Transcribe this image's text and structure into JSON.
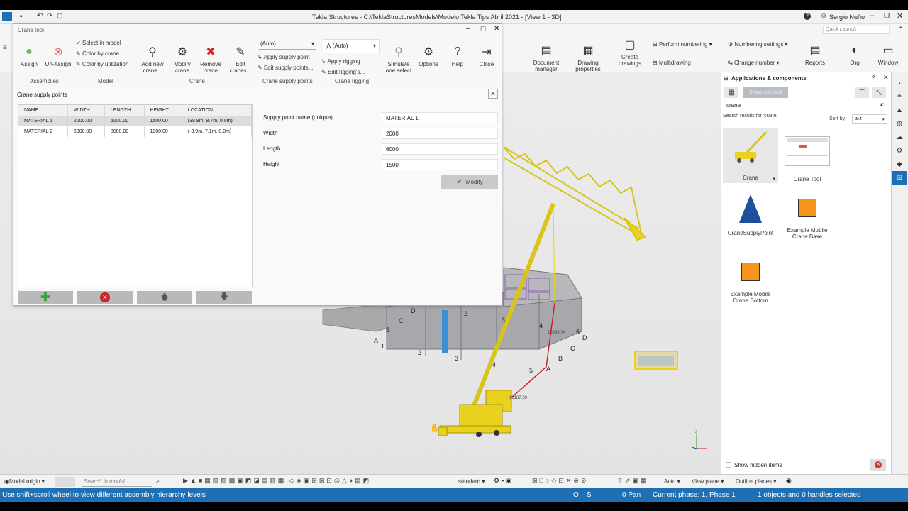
{
  "app": {
    "title": "Tekla Structures - C:\\TeklaStructuresModels\\Modelo Tekla Tips Abril 2021 - [View 1 - 3D]",
    "user": "Sergio Nuño",
    "quick_launch_placeholder": "Quick Launch"
  },
  "main_ribbon": {
    "document_manager": "Document manager",
    "drawing_properties": "Drawing properties",
    "create_drawings": "Create drawings",
    "perform_numbering": "Perform numbering",
    "multidrawing": "Multidrawing",
    "numbering_settings": "Numbering settings",
    "change_number": "Change number",
    "reports": "Reports",
    "org": "Org",
    "window": "Window"
  },
  "dialog": {
    "title": "Crane tool",
    "ribbon": {
      "assign": "Assign",
      "unassign": "Un-Assign",
      "select_in_model": "Select in model",
      "color_by_crane": "Color by crane",
      "color_by_utilization": "Color by utilization",
      "add_new_crane": "Add new crane...",
      "modify_crane": "Modify crane",
      "remove_crane": "Remove crane",
      "edit_cranes": "Edit cranes...",
      "supply_dropdown": "(Auto)",
      "apply_supply_point": "Apply supply point",
      "edit_supply_points": "Edit supply points...",
      "rigging_dropdown": "(Auto)",
      "apply_rigging": "Apply rigging",
      "edit_riggings": "Edit rigging's...",
      "simulate": "Simulate one select",
      "options": "Options",
      "help": "Help",
      "close": "Close"
    },
    "groups": {
      "assemblies": "Assemblies",
      "model": "Model",
      "crane": "Crane",
      "crane_supply_points": "Crane supply points",
      "crane_rigging": "Crane rigging"
    },
    "panel_title": "Crane supply points",
    "table": {
      "headers": [
        "NAME",
        "WIDTH",
        "LENGTH",
        "HEIGHT",
        "LOCATION"
      ],
      "rows": [
        [
          "MATERIAL 1",
          "2000.00",
          "6000.00",
          "1500.00",
          "(38.8m, 8.7m, 0.0m)"
        ],
        [
          "MATERIAL 2",
          "6000.00",
          "8000.00",
          "1000.00",
          "(-8.9m, 7.1m, 0.0m)"
        ]
      ]
    },
    "form": {
      "name_label": "Supply point name (unique)",
      "name_value": "MATERIAL 1",
      "width_label": "Width",
      "width_value": "2000",
      "length_label": "Length",
      "length_value": "6000",
      "height_label": "Height",
      "height_value": "1500",
      "modify_button": "Modify"
    }
  },
  "apps_panel": {
    "title": "Applications & components",
    "show_selected": "Show selected",
    "search_value": "crane",
    "results_label": "Search results for 'crane'",
    "sort_by": "Sort by",
    "sort_value": "a-z",
    "items": [
      "Crane",
      "Crane Tool",
      "CraneSupplyPoint",
      "Example Mobile Crane Base",
      "Example Mobile Crane Bottom"
    ],
    "show_hidden": "Show hidden items"
  },
  "viewport": {
    "grid_letters": [
      "A",
      "B",
      "C",
      "D",
      "A",
      "B",
      "C",
      "D"
    ],
    "grid_numbers": [
      "1",
      "2",
      "3",
      "4",
      "5",
      "1",
      "2",
      "3",
      "4",
      "5"
    ],
    "dim1": "16083.74",
    "dim2": "19187.59"
  },
  "bottom_bar": {
    "model_origin": "Model origin",
    "search_placeholder": "Search in model",
    "standard": "standard",
    "auto": "Auto",
    "view_plane": "View plane",
    "outline_planes": "Outline planes"
  },
  "status": {
    "hint": "Use shift+scroll wheel to view different assembly hierarchy levels",
    "o": "O",
    "s": "S",
    "pan": "0 Pan",
    "phase": "Current phase: 1, Phase 1",
    "selection": "1 objects and 0 handles selected"
  },
  "colors": {
    "accent": "#1f6fb5",
    "crane": "#e8d21e",
    "orange": "#f7941d",
    "blue": "#1e4f9c"
  }
}
